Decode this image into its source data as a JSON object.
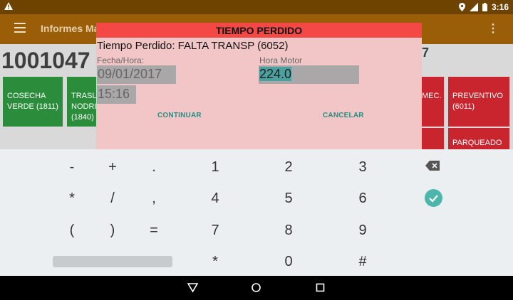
{
  "status_bar": {
    "time": "3:16"
  },
  "app_bar": {
    "title": "Informes Ma"
  },
  "background": {
    "id_number": "1001047",
    "right_number": "7",
    "tiles": [
      {
        "label": "COSECHA VERDE (1811)"
      },
      {
        "label": "TRASL NODRI (1840)"
      },
      {
        "label": "MEC."
      },
      {
        "label": "PREVENTIVO (6011)"
      },
      {
        "label": "PARQUEADO"
      }
    ]
  },
  "dialog": {
    "title": "TIEMPO PERDIDO",
    "subtitle": "Tiempo Perdido: FALTA TRANSP (6052)",
    "date_label": "Fecha/Hora:",
    "date_value": "09/01/2017",
    "time_value": "15:16",
    "motor_label": "Hora Motor",
    "motor_value": "224.0",
    "continue_label": "CONTINUAR",
    "cancel_label": "CANCELAR"
  },
  "keyboard": {
    "row1": [
      "-",
      "+",
      ".",
      "1",
      "2",
      "3"
    ],
    "row2": [
      "*",
      "/",
      ",",
      "4",
      "5",
      "6"
    ],
    "row3": [
      "(",
      ")",
      "=",
      "7",
      "8",
      "9"
    ],
    "row4": [
      "*",
      "0",
      "#"
    ]
  },
  "colors": {
    "status_bar": "#6e4300",
    "app_bar": "#9a5e08",
    "dialog_title": "#f44846",
    "dialog_bg": "#f2c6c6",
    "accent": "#4db6ac",
    "tile_green": "#2b8d3c",
    "tile_red": "#c9252e"
  }
}
